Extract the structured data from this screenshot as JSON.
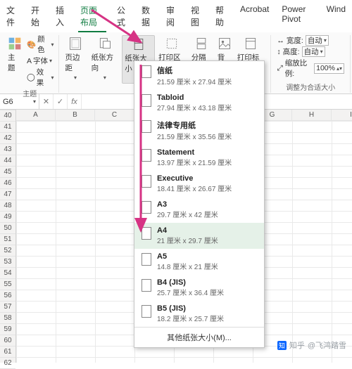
{
  "tabs": [
    "文件",
    "开始",
    "插入",
    "页面布局",
    "公式",
    "数据",
    "审阅",
    "视图",
    "帮助",
    "Acrobat",
    "Power Pivot",
    "Wind"
  ],
  "active_tab_index": 3,
  "theme_group": {
    "main": "主题",
    "opt_color": "颜色",
    "opt_font": "字体",
    "opt_effect": "效果",
    "label": "主题"
  },
  "page_setup": {
    "margins": "页边距",
    "orientation": "纸张方向",
    "size": "纸张大小",
    "print_area": "打印区域",
    "breaks": "分隔符",
    "background": "背景",
    "titles": "打印标题"
  },
  "scaling": {
    "width_lbl": "宽度:",
    "height_lbl": "高度:",
    "scale_lbl": "缩放比例:",
    "auto": "自动",
    "scale_val": "100%",
    "group_label": "调整为合适大小"
  },
  "namebox": "G6",
  "fx": "fx",
  "columns": [
    "A",
    "B",
    "C",
    "",
    "",
    "",
    "G",
    "H",
    "I"
  ],
  "rows": [
    "40",
    "41",
    "42",
    "43",
    "44",
    "45",
    "46",
    "47",
    "48",
    "49",
    "50",
    "51",
    "52",
    "53",
    "54",
    "55",
    "56",
    "57",
    "58",
    "59",
    "60",
    "61",
    "62"
  ],
  "dropdown": {
    "items": [
      {
        "name": "信纸",
        "dim": "21.59 厘米 x 27.94 厘米"
      },
      {
        "name": "Tabloid",
        "dim": "27.94 厘米 x 43.18 厘米"
      },
      {
        "name": "法律专用纸",
        "dim": "21.59 厘米 x 35.56 厘米"
      },
      {
        "name": "Statement",
        "dim": "13.97 厘米 x 21.59 厘米"
      },
      {
        "name": "Executive",
        "dim": "18.41 厘米 x 26.67 厘米"
      },
      {
        "name": "A3",
        "dim": "29.7 厘米 x 42 厘米"
      },
      {
        "name": "A4",
        "dim": "21 厘米 x 29.7 厘米"
      },
      {
        "name": "A5",
        "dim": "14.8 厘米 x 21 厘米"
      },
      {
        "name": "B4 (JIS)",
        "dim": "25.7 厘米 x 36.4 厘米"
      },
      {
        "name": "B5 (JIS)",
        "dim": "18.2 厘米 x 25.7 厘米"
      }
    ],
    "hover_index": 6,
    "more": "其他纸张大小(M)..."
  },
  "watermark": {
    "site": "知乎",
    "author": "@飞鸿踏雪"
  }
}
